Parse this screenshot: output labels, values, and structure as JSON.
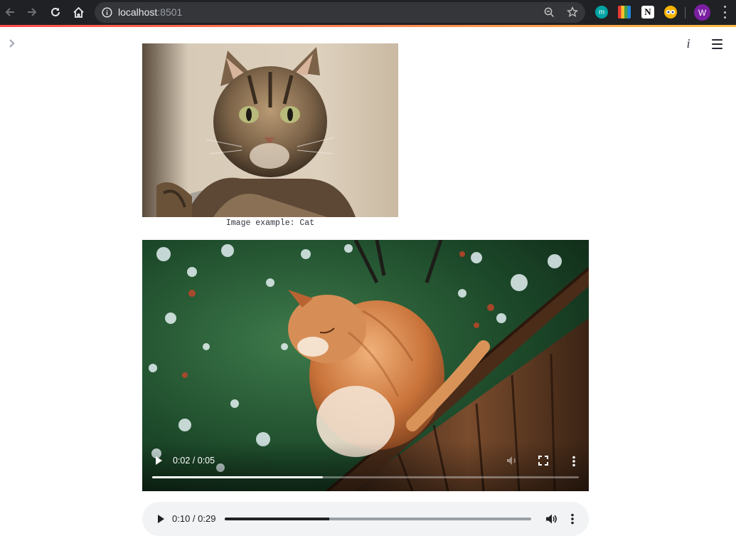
{
  "browser": {
    "url_host": "localhost",
    "url_port": ":8501",
    "profile_initial": "W",
    "extension_letter": "m"
  },
  "page": {
    "image_caption": "Image example: Cat"
  },
  "video_player": {
    "time_display": "0:02 / 0:05",
    "progress_fraction": 0.4
  },
  "audio_player": {
    "time_display": "0:10 / 0:29",
    "progress_fraction": 0.34
  },
  "colors": {
    "browser_chrome": "#202124",
    "streamlit_accent": "#ff4b4b",
    "profile_avatar": "#7b1fa2"
  }
}
